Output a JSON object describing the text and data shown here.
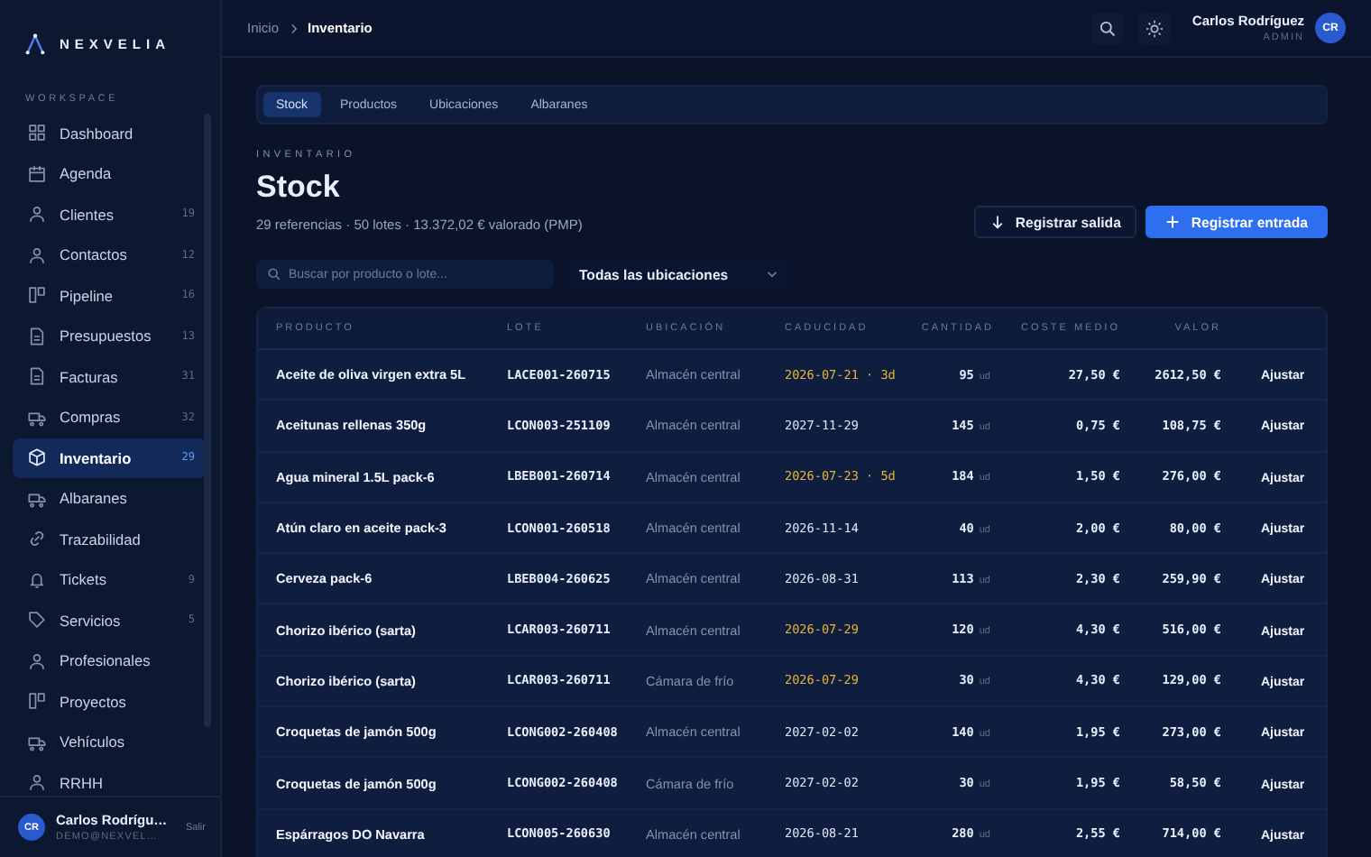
{
  "brand": {
    "name": "NEXVELIA"
  },
  "sidebar": {
    "section": "WORKSPACE",
    "items": [
      {
        "label": "Dashboard",
        "selected": false
      },
      {
        "label": "Agenda",
        "selected": false
      },
      {
        "label": "Clientes",
        "count": "19",
        "selected": false
      },
      {
        "label": "Contactos",
        "count": "12",
        "selected": false
      },
      {
        "label": "Pipeline",
        "count": "16",
        "selected": false
      },
      {
        "label": "Presupuestos",
        "count": "13",
        "selected": false
      },
      {
        "label": "Facturas",
        "count": "31",
        "selected": false
      },
      {
        "label": "Compras",
        "count": "32",
        "selected": false
      },
      {
        "label": "Inventario",
        "count": "29",
        "selected": true
      },
      {
        "label": "Albaranes",
        "selected": false
      },
      {
        "label": "Trazabilidad",
        "selected": false
      },
      {
        "label": "Tickets",
        "count": "9",
        "selected": false
      },
      {
        "label": "Servicios",
        "count": "5",
        "selected": false
      },
      {
        "label": "Profesionales",
        "selected": false
      },
      {
        "label": "Proyectos",
        "selected": false
      },
      {
        "label": "Vehículos",
        "selected": false
      },
      {
        "label": "RRHH",
        "selected": false
      }
    ],
    "user": {
      "initials": "CR",
      "name": "Carlos Rodrígu…",
      "email": "DEMO@NEXVEL…",
      "logout": "Salir"
    }
  },
  "breadcrumb": [
    "Inicio",
    "Inventario"
  ],
  "topbar_user": {
    "name": "Carlos Rodríguez",
    "role": "ADMIN",
    "initials": "CR"
  },
  "tabs": [
    {
      "label": "Stock",
      "selected": true
    },
    {
      "label": "Productos",
      "selected": false
    },
    {
      "label": "Ubicaciones",
      "selected": false
    },
    {
      "label": "Albaranes",
      "selected": false
    }
  ],
  "eyebrow": "INVENTARIO",
  "title": "Stock",
  "summary": "29 referencias · 50 lotes · 13.372,02 € valorado (PMP)",
  "buttons": [
    {
      "label": "Registrar salida",
      "kind": "secondary"
    },
    {
      "label": "Registrar entrada",
      "kind": "primary"
    }
  ],
  "search": {
    "placeholder": "Buscar por producto o lote..."
  },
  "location_filter": {
    "value": "Todas las ubicaciones"
  },
  "table": {
    "columns": [
      "PRODUCTO",
      "LOTE",
      "UBICACIÓN",
      "CADUCIDAD",
      "CANTIDAD",
      "COSTE MEDIO",
      "VALOR"
    ],
    "rows": [
      {
        "product": "Aceite de oliva virgen extra 5L",
        "lot": "LACE001-260715",
        "location": "Almacén central",
        "expiry": "2026-07-21 · 3d",
        "expiring": true,
        "quantity": "95",
        "unit": "ud",
        "cost": "27,50 €",
        "value": "2612,50 €",
        "action": "Ajustar"
      },
      {
        "product": "Aceitunas rellenas 350g",
        "lot": "LCON003-251109",
        "location": "Almacén central",
        "expiry": "2027-11-29",
        "expiring": false,
        "quantity": "145",
        "unit": "ud",
        "cost": "0,75 €",
        "value": "108,75 €",
        "action": "Ajustar"
      },
      {
        "product": "Agua mineral 1.5L pack-6",
        "lot": "LBEB001-260714",
        "location": "Almacén central",
        "expiry": "2026-07-23 · 5d",
        "expiring": true,
        "quantity": "184",
        "unit": "ud",
        "cost": "1,50 €",
        "value": "276,00 €",
        "action": "Ajustar"
      },
      {
        "product": "Atún claro en aceite pack-3",
        "lot": "LCON001-260518",
        "location": "Almacén central",
        "expiry": "2026-11-14",
        "expiring": false,
        "quantity": "40",
        "unit": "ud",
        "cost": "2,00 €",
        "value": "80,00 €",
        "action": "Ajustar"
      },
      {
        "product": "Cerveza pack-6",
        "lot": "LBEB004-260625",
        "location": "Almacén central",
        "expiry": "2026-08-31",
        "expiring": false,
        "quantity": "113",
        "unit": "ud",
        "cost": "2,30 €",
        "value": "259,90 €",
        "action": "Ajustar"
      },
      {
        "product": "Chorizo ibérico (sarta)",
        "lot": "LCAR003-260711",
        "location": "Almacén central",
        "expiry": "2026-07-29",
        "expiring": true,
        "quantity": "120",
        "unit": "ud",
        "cost": "4,30 €",
        "value": "516,00 €",
        "action": "Ajustar"
      },
      {
        "product": "Chorizo ibérico (sarta)",
        "lot": "LCAR003-260711",
        "location": "Cámara de frío",
        "expiry": "2026-07-29",
        "expiring": true,
        "quantity": "30",
        "unit": "ud",
        "cost": "4,30 €",
        "value": "129,00 €",
        "action": "Ajustar"
      },
      {
        "product": "Croquetas de jamón 500g",
        "lot": "LCONG002-260408",
        "location": "Almacén central",
        "expiry": "2027-02-02",
        "expiring": false,
        "quantity": "140",
        "unit": "ud",
        "cost": "1,95 €",
        "value": "273,00 €",
        "action": "Ajustar"
      },
      {
        "product": "Croquetas de jamón 500g",
        "lot": "LCONG002-260408",
        "location": "Cámara de frío",
        "expiry": "2027-02-02",
        "expiring": false,
        "quantity": "30",
        "unit": "ud",
        "cost": "1,95 €",
        "value": "58,50 €",
        "action": "Ajustar"
      },
      {
        "product": "Espárragos DO Navarra",
        "lot": "LCON005-260630",
        "location": "Almacén central",
        "expiry": "2026-08-21",
        "expiring": false,
        "quantity": "280",
        "unit": "ud",
        "cost": "2,55 €",
        "value": "714,00 €",
        "action": "Ajustar"
      }
    ]
  }
}
